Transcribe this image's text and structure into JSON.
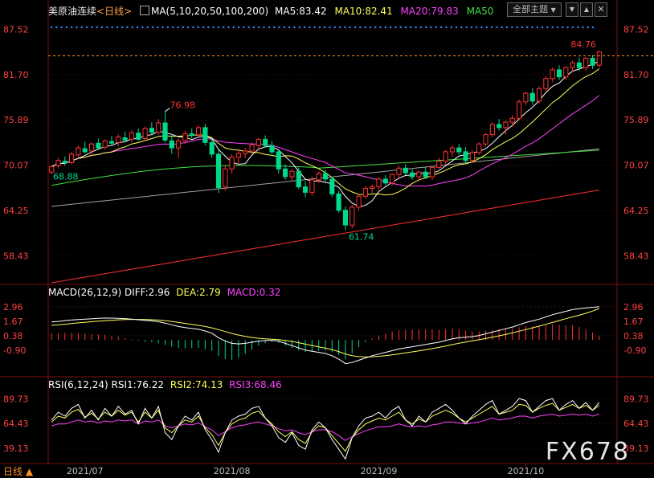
{
  "header": {
    "symbol": "美原油连续",
    "period": "<日线>",
    "ma_label": "MA(5,10,20,50,100,200)",
    "ma5": "MA5:83.42",
    "ma10": "MA10:82.41",
    "ma20": "MA20:79.83",
    "ma50": "MA50",
    "theme_button": "全部主题",
    "nav_down": "▼",
    "nav_up": "▲",
    "close": "✕"
  },
  "macd": {
    "label": "MACD(26,12,9)",
    "diff": "DIFF:2.96",
    "dea": "DEA:2.79",
    "macd": "MACD:0.32"
  },
  "rsi": {
    "label": "RSI(6,12,24)",
    "rsi1": "RSI1:76.22",
    "rsi2": "RSI2:74.13",
    "rsi3": "RSI3:68.46"
  },
  "footer": {
    "period": "日线 ▲"
  },
  "watermark": "FX678",
  "colors": {
    "up": "#ff3232",
    "down": "#00d88a",
    "ma5": "#ffffff",
    "ma10": "#ffff5a",
    "ma20": "#ff40ff",
    "ma50": "#40e040",
    "ma100": "#a0a0a0",
    "ma200": "#ff3030",
    "axis": "#ff4040",
    "macd_diff": "#ffffff",
    "macd_dea": "#ffff5a"
  },
  "chart_data": [
    {
      "type": "candlestick",
      "ylim": [
        55.0,
        89.0
      ],
      "yticks": [
        "87.52",
        "81.70",
        "75.89",
        "70.07",
        "64.25",
        "58.43"
      ],
      "xticks": [
        "2021/07",
        "2021/08",
        "2021/09",
        "2021/10"
      ],
      "annotations": [
        {
          "text": "76.98",
          "kind": "high"
        },
        {
          "text": "68.88",
          "kind": "low"
        },
        {
          "text": "61.74",
          "kind": "low"
        },
        {
          "text": "84.76",
          "kind": "last"
        }
      ],
      "candles": [
        [
          69.2,
          70.1,
          68.9,
          69.9
        ],
        [
          70.0,
          71.0,
          69.7,
          70.7
        ],
        [
          70.6,
          71.2,
          70.0,
          70.4
        ],
        [
          70.4,
          71.8,
          70.2,
          71.5
        ],
        [
          71.4,
          72.6,
          71.1,
          72.3
        ],
        [
          72.2,
          73.1,
          71.6,
          71.8
        ],
        [
          71.9,
          73.0,
          71.5,
          72.8
        ],
        [
          72.9,
          73.5,
          72.0,
          72.3
        ],
        [
          72.4,
          73.4,
          72.1,
          73.2
        ],
        [
          73.1,
          73.8,
          72.6,
          72.9
        ],
        [
          73.0,
          74.0,
          72.5,
          73.7
        ],
        [
          73.6,
          74.4,
          73.0,
          73.3
        ],
        [
          73.4,
          74.6,
          73.0,
          74.2
        ],
        [
          74.2,
          74.8,
          73.2,
          73.4
        ],
        [
          73.5,
          75.0,
          73.2,
          74.8
        ],
        [
          74.8,
          75.6,
          74.0,
          74.3
        ],
        [
          74.3,
          76.0,
          74.0,
          75.5
        ],
        [
          75.5,
          76.98,
          73.0,
          73.3
        ],
        [
          73.2,
          74.0,
          71.5,
          72.3
        ],
        [
          72.3,
          73.5,
          71.0,
          73.2
        ],
        [
          73.2,
          74.5,
          72.8,
          74.1
        ],
        [
          74.1,
          74.8,
          73.5,
          73.9
        ],
        [
          74.0,
          75.2,
          73.7,
          74.9
        ],
        [
          74.9,
          75.4,
          72.6,
          73.0
        ],
        [
          73.0,
          73.5,
          71.0,
          71.5
        ],
        [
          71.5,
          72.0,
          66.5,
          67.2
        ],
        [
          67.3,
          70.0,
          66.8,
          69.6
        ],
        [
          69.6,
          71.5,
          69.0,
          71.1
        ],
        [
          71.1,
          72.0,
          70.2,
          71.6
        ],
        [
          71.6,
          72.3,
          71.0,
          71.9
        ],
        [
          71.9,
          73.0,
          71.5,
          72.7
        ],
        [
          72.6,
          73.6,
          72.0,
          73.4
        ],
        [
          73.4,
          73.9,
          72.3,
          72.6
        ],
        [
          72.6,
          73.2,
          71.5,
          71.8
        ],
        [
          71.8,
          72.0,
          69.0,
          69.6
        ],
        [
          69.6,
          70.2,
          68.2,
          68.6
        ],
        [
          68.6,
          69.6,
          68.0,
          69.3
        ],
        [
          69.3,
          69.8,
          67.0,
          67.3
        ],
        [
          67.3,
          68.0,
          66.0,
          66.6
        ],
        [
          66.6,
          68.6,
          66.2,
          68.2
        ],
        [
          68.2,
          69.3,
          67.8,
          69.0
        ],
        [
          69.0,
          69.5,
          68.0,
          68.3
        ],
        [
          68.3,
          68.6,
          66.0,
          66.4
        ],
        [
          66.4,
          66.8,
          64.0,
          64.3
        ],
        [
          64.3,
          64.8,
          61.74,
          62.4
        ],
        [
          62.4,
          65.0,
          62.0,
          64.7
        ],
        [
          64.7,
          66.3,
          64.3,
          66.1
        ],
        [
          66.1,
          67.4,
          65.8,
          67.1
        ],
        [
          67.1,
          67.6,
          66.5,
          67.3
        ],
        [
          67.3,
          68.5,
          67.0,
          68.3
        ],
        [
          68.3,
          68.8,
          67.5,
          67.8
        ],
        [
          67.8,
          69.0,
          67.5,
          68.9
        ],
        [
          68.9,
          70.0,
          68.4,
          69.7
        ],
        [
          69.7,
          70.2,
          68.8,
          69.1
        ],
        [
          69.1,
          69.6,
          68.2,
          68.6
        ],
        [
          68.6,
          69.4,
          68.0,
          69.2
        ],
        [
          69.2,
          69.8,
          68.3,
          68.6
        ],
        [
          68.6,
          70.0,
          68.2,
          69.8
        ],
        [
          69.8,
          71.0,
          69.6,
          70.6
        ],
        [
          70.6,
          72.0,
          70.2,
          71.8
        ],
        [
          71.8,
          72.6,
          71.2,
          72.3
        ],
        [
          72.3,
          72.8,
          71.4,
          71.8
        ],
        [
          71.8,
          72.4,
          70.2,
          70.7
        ],
        [
          70.7,
          72.0,
          70.4,
          71.7
        ],
        [
          71.7,
          73.0,
          71.4,
          72.8
        ],
        [
          72.8,
          74.2,
          72.5,
          74.0
        ],
        [
          74.0,
          75.6,
          73.7,
          75.3
        ],
        [
          75.3,
          76.0,
          74.5,
          74.9
        ],
        [
          74.9,
          75.8,
          74.0,
          75.6
        ],
        [
          75.6,
          76.5,
          75.0,
          76.1
        ],
        [
          76.1,
          78.5,
          75.8,
          78.2
        ],
        [
          78.2,
          79.5,
          77.8,
          79.3
        ],
        [
          79.3,
          80.0,
          77.8,
          78.3
        ],
        [
          78.3,
          80.2,
          78.0,
          79.9
        ],
        [
          79.9,
          81.5,
          79.6,
          81.2
        ],
        [
          81.2,
          82.6,
          80.8,
          82.3
        ],
        [
          82.3,
          82.9,
          81.0,
          81.4
        ],
        [
          81.4,
          82.8,
          81.0,
          82.6
        ],
        [
          82.6,
          83.5,
          82.0,
          83.2
        ],
        [
          83.2,
          83.9,
          82.2,
          82.6
        ],
        [
          82.6,
          84.0,
          82.2,
          83.8
        ],
        [
          83.8,
          84.2,
          82.4,
          82.9
        ],
        [
          82.9,
          84.76,
          82.6,
          84.6
        ]
      ]
    },
    {
      "type": "macd",
      "ylim": [
        -3.2,
        3.8
      ],
      "yticks": [
        "2.96",
        "1.67",
        "0.38",
        "-0.90"
      ],
      "series": [
        {
          "name": "DIFF",
          "values": [
            1.6,
            1.65,
            1.72,
            1.78,
            1.82,
            1.86,
            1.88,
            1.92,
            1.95,
            1.94,
            1.93,
            1.9,
            1.86,
            1.8,
            1.74,
            1.7,
            1.62,
            1.5,
            1.35,
            1.2,
            1.1,
            1.02,
            0.95,
            0.8,
            0.6,
            0.2,
            -0.1,
            -0.3,
            -0.35,
            -0.3,
            -0.2,
            -0.1,
            -0.05,
            -0.02,
            -0.1,
            -0.3,
            -0.5,
            -0.7,
            -0.9,
            -1.0,
            -1.1,
            -1.2,
            -1.4,
            -1.7,
            -2.1,
            -2.0,
            -1.8,
            -1.6,
            -1.4,
            -1.25,
            -1.1,
            -0.95,
            -0.8,
            -0.7,
            -0.6,
            -0.5,
            -0.4,
            -0.3,
            -0.2,
            -0.05,
            0.1,
            0.2,
            0.25,
            0.3,
            0.4,
            0.55,
            0.7,
            0.85,
            1.0,
            1.15,
            1.35,
            1.55,
            1.7,
            1.85,
            2.05,
            2.25,
            2.4,
            2.55,
            2.7,
            2.78,
            2.85,
            2.9,
            2.96
          ]
        },
        {
          "name": "DEA",
          "values": [
            1.3,
            1.35,
            1.4,
            1.46,
            1.52,
            1.57,
            1.62,
            1.67,
            1.72,
            1.76,
            1.79,
            1.82,
            1.83,
            1.83,
            1.82,
            1.8,
            1.77,
            1.72,
            1.65,
            1.56,
            1.47,
            1.38,
            1.3,
            1.2,
            1.08,
            0.92,
            0.75,
            0.58,
            0.44,
            0.32,
            0.22,
            0.15,
            0.1,
            0.07,
            0.03,
            -0.04,
            -0.13,
            -0.24,
            -0.37,
            -0.49,
            -0.61,
            -0.73,
            -0.86,
            -1.03,
            -1.24,
            -1.39,
            -1.48,
            -1.51,
            -1.49,
            -1.45,
            -1.39,
            -1.32,
            -1.24,
            -1.15,
            -1.06,
            -0.97,
            -0.87,
            -0.77,
            -0.66,
            -0.54,
            -0.41,
            -0.29,
            -0.18,
            -0.08,
            0.02,
            0.13,
            0.25,
            0.37,
            0.5,
            0.63,
            0.78,
            0.93,
            1.08,
            1.23,
            1.39,
            1.56,
            1.73,
            1.89,
            2.05,
            2.2,
            2.37,
            2.57,
            2.79
          ]
        }
      ]
    },
    {
      "type": "rsi",
      "ylim": [
        25,
        100
      ],
      "yticks": [
        "89.73",
        "64.43",
        "39.13"
      ],
      "series": [
        {
          "name": "RSI1",
          "values": [
            68,
            76,
            72,
            80,
            84,
            70,
            78,
            68,
            80,
            72,
            82,
            74,
            78,
            64,
            80,
            70,
            82,
            55,
            48,
            62,
            72,
            68,
            76,
            58,
            48,
            35,
            55,
            68,
            72,
            74,
            80,
            82,
            70,
            62,
            50,
            45,
            55,
            42,
            38,
            58,
            66,
            60,
            48,
            38,
            28,
            50,
            62,
            70,
            72,
            76,
            70,
            78,
            82,
            68,
            62,
            72,
            66,
            76,
            80,
            84,
            78,
            70,
            64,
            72,
            78,
            84,
            88,
            74,
            78,
            82,
            90,
            88,
            76,
            82,
            88,
            90,
            78,
            84,
            88,
            80,
            86,
            78,
            86
          ]
        },
        {
          "name": "RSI2",
          "values": [
            66,
            72,
            70,
            76,
            79,
            71,
            75,
            69,
            76,
            72,
            78,
            73,
            76,
            66,
            76,
            70,
            78,
            60,
            55,
            62,
            68,
            66,
            72,
            60,
            53,
            42,
            55,
            64,
            68,
            70,
            75,
            77,
            70,
            64,
            56,
            51,
            56,
            48,
            44,
            56,
            62,
            60,
            52,
            44,
            36,
            50,
            58,
            64,
            67,
            70,
            68,
            72,
            76,
            68,
            64,
            69,
            66,
            72,
            75,
            78,
            75,
            70,
            66,
            70,
            74,
            78,
            82,
            74,
            76,
            78,
            84,
            83,
            76,
            80,
            83,
            85,
            78,
            81,
            84,
            80,
            83,
            78,
            83
          ]
        },
        {
          "name": "RSI3",
          "values": [
            62,
            64,
            64,
            66,
            68,
            66,
            67,
            65,
            67,
            66,
            68,
            67,
            68,
            64,
            67,
            66,
            68,
            62,
            60,
            62,
            64,
            63,
            65,
            61,
            58,
            52,
            56,
            60,
            62,
            63,
            65,
            66,
            64,
            62,
            59,
            57,
            58,
            55,
            53,
            56,
            58,
            58,
            56,
            52,
            47,
            51,
            54,
            57,
            59,
            61,
            61,
            62,
            64,
            62,
            61,
            62,
            61,
            63,
            64,
            66,
            66,
            65,
            64,
            65,
            66,
            68,
            70,
            68,
            69,
            70,
            72,
            72,
            70,
            72,
            73,
            74,
            72,
            73,
            74,
            73,
            74,
            72,
            74
          ]
        }
      ]
    }
  ]
}
